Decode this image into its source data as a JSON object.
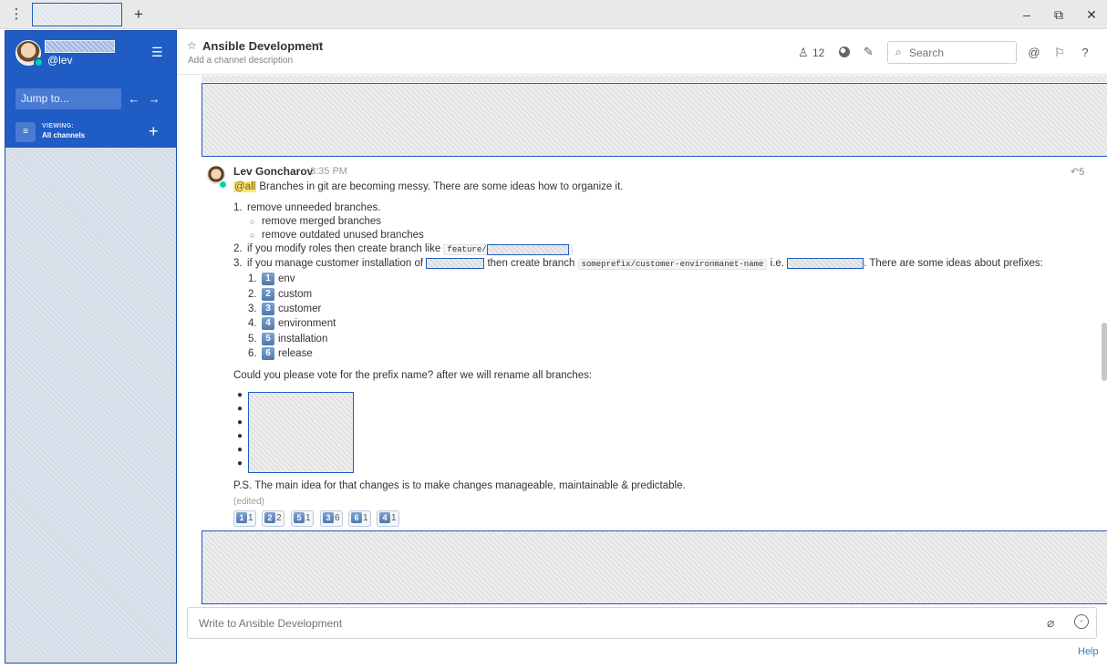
{
  "titlebar": {
    "menu_icon": "vertical-dots-icon",
    "add_tab": "+",
    "minimize": "–",
    "restore": "⧉",
    "close": "✕"
  },
  "sidebar": {
    "handle": "@lev",
    "jump_placeholder": "Jump to...",
    "back_arrow": "←",
    "forward_arrow": "→",
    "viewing_label": "VIEWING:",
    "viewing_value": "All channels",
    "add": "+"
  },
  "header": {
    "star": "☆",
    "channel_name": "Ansible Development",
    "chevron": "﹀",
    "description": "Add a channel description",
    "member_count": "12",
    "search_placeholder": "Search"
  },
  "message": {
    "author": "Lev Goncharov",
    "time": "3:35 PM",
    "reply_count": "5",
    "mention": "@all",
    "intro": "Branches in git are becoming messy. There are some ideas how to organize it.",
    "items": [
      {
        "num": "1.",
        "text": "remove unneeded branches."
      },
      {
        "num": "2.",
        "text": "if you modify roles then create branch like",
        "code": "feature/"
      },
      {
        "num": "3.",
        "text_a": "if you manage customer installation of",
        "text_b": "then create branch",
        "code": "someprefix/customer-environmanet-name",
        "text_c": "i.e.",
        "text_d": ". There are some ideas about prefixes:"
      }
    ],
    "sub_items": [
      "remove merged branches",
      "remove outdated unused branches"
    ],
    "prefixes": [
      {
        "num": "1.",
        "emoji": "1",
        "label": "env"
      },
      {
        "num": "2.",
        "emoji": "2",
        "label": "custom"
      },
      {
        "num": "3.",
        "emoji": "3",
        "label": "customer"
      },
      {
        "num": "4.",
        "emoji": "4",
        "label": "environment"
      },
      {
        "num": "5.",
        "emoji": "5",
        "label": "installation"
      },
      {
        "num": "6.",
        "emoji": "6",
        "label": "release"
      }
    ],
    "vote_text": "Could you please vote for the prefix name? after we will rename all branches:",
    "ps": "P.S. The main idea for that changes is to make changes manageable, maintainable & predictable.",
    "edited": "(edited)",
    "reactions": [
      {
        "emoji": "1",
        "count": "1"
      },
      {
        "emoji": "2",
        "count": "2"
      },
      {
        "emoji": "5",
        "count": "1"
      },
      {
        "emoji": "3",
        "count": "6"
      },
      {
        "emoji": "6",
        "count": "1"
      },
      {
        "emoji": "4",
        "count": "1"
      }
    ]
  },
  "composer": {
    "placeholder": "Write to Ansible Development"
  },
  "help": "Help",
  "colors": {
    "sidebar": "#1f5cc4",
    "mention": "#ffe577",
    "link": "#2f81b7"
  }
}
